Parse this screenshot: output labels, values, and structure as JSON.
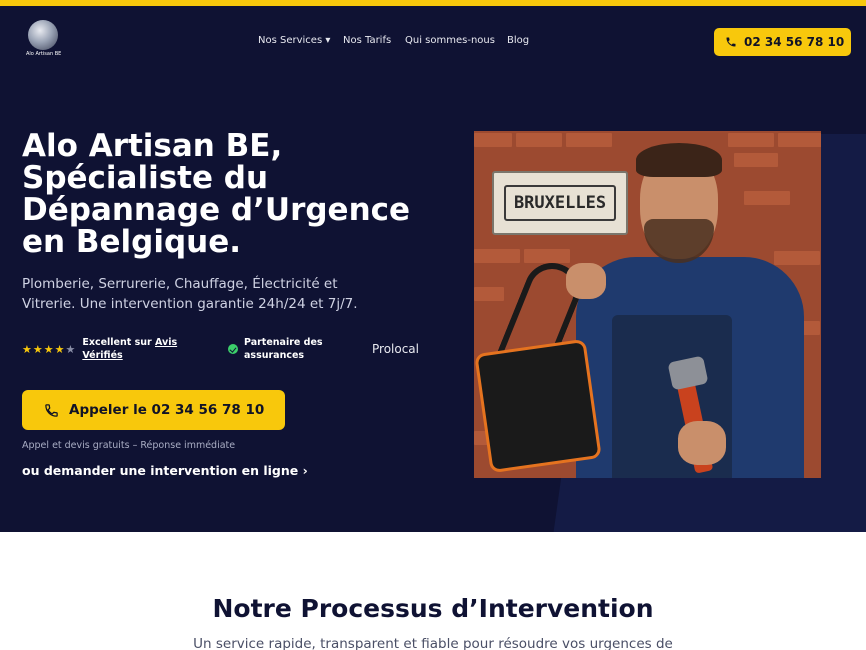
{
  "brand": {
    "name": "Alo Artisan BE",
    "accent": "#f8c80c",
    "navy": "#0f1233"
  },
  "nav": {
    "items": [
      "Nos Services ▾",
      "Nos Tarifs",
      "Qui sommes-nous",
      "Blog"
    ]
  },
  "header": {
    "phone_cta": "02 34 56 78 10",
    "phone_icon": "phone-icon"
  },
  "hero": {
    "title": "Alo Artisan BE, Spécialiste du Dépannage d’Urgence en Belgique.",
    "subtitle": "Plomberie, Serrurerie, Chauffage, Électricité et Vitrerie. Une intervention garantie 24h/24 et 7j/7.",
    "rating": {
      "stars_filled": 4,
      "stars_total": 5,
      "text_prefix": "Excellent sur ",
      "link": "Avis Vérifiés"
    },
    "partner": "Partenaire des assurances",
    "prolocal": "Prolocal",
    "cta": "Appeler le 02 34 56 78 10",
    "note": "Appel et devis gratuits – Réponse immédiate",
    "online_link": "ou demander une intervention en ligne ›",
    "photo_sign": "BRUXELLES"
  },
  "process": {
    "title": "Notre Processus d’Intervention",
    "subtitle": "Un service rapide, transparent et fiable pour résoudre vos urgences de"
  }
}
